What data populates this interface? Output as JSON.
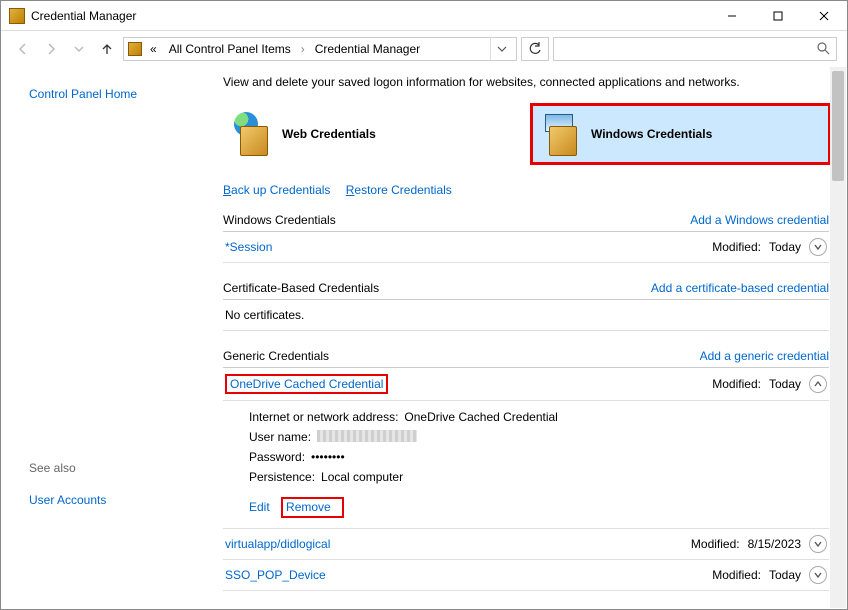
{
  "window": {
    "title": "Credential Manager"
  },
  "breadcrumb": {
    "prefix": "«",
    "items": [
      "All Control Panel Items",
      "Credential Manager"
    ]
  },
  "intro": "View and delete your saved logon information for websites, connected applications and networks.",
  "sidebar": {
    "home": "Control Panel Home",
    "see_also_label": "See also",
    "user_accounts": "User Accounts"
  },
  "cred_tabs": {
    "web": "Web Credentials",
    "windows": "Windows Credentials"
  },
  "link_row": {
    "backup": "Back up Credentials",
    "backup_ul_char": "B",
    "restore": "Restore Credentials",
    "restore_ul_char": "R"
  },
  "sections": {
    "windows": {
      "title": "Windows Credentials",
      "add_link": "Add a Windows credential",
      "rows": [
        {
          "name": "*Session",
          "modified": "Today"
        }
      ]
    },
    "cert": {
      "title": "Certificate-Based Credentials",
      "add_link": "Add a certificate-based credential",
      "empty": "No certificates."
    },
    "generic": {
      "title": "Generic Credentials",
      "add_link": "Add a generic credential",
      "expanded": {
        "name": "OneDrive Cached Credential",
        "modified": "Today",
        "address_label": "Internet or network address:",
        "address_value": "OneDrive Cached Credential",
        "user_label": "User name:",
        "pass_label": "Password:",
        "pass_value": "••••••••",
        "persist_label": "Persistence:",
        "persist_value": "Local computer",
        "edit": "Edit",
        "remove": "Remove"
      },
      "rows": [
        {
          "name": "virtualapp/didlogical",
          "modified": "8/15/2023"
        },
        {
          "name": "SSO_POP_Device",
          "modified": "Today"
        }
      ]
    }
  },
  "labels": {
    "modified": "Modified:"
  }
}
